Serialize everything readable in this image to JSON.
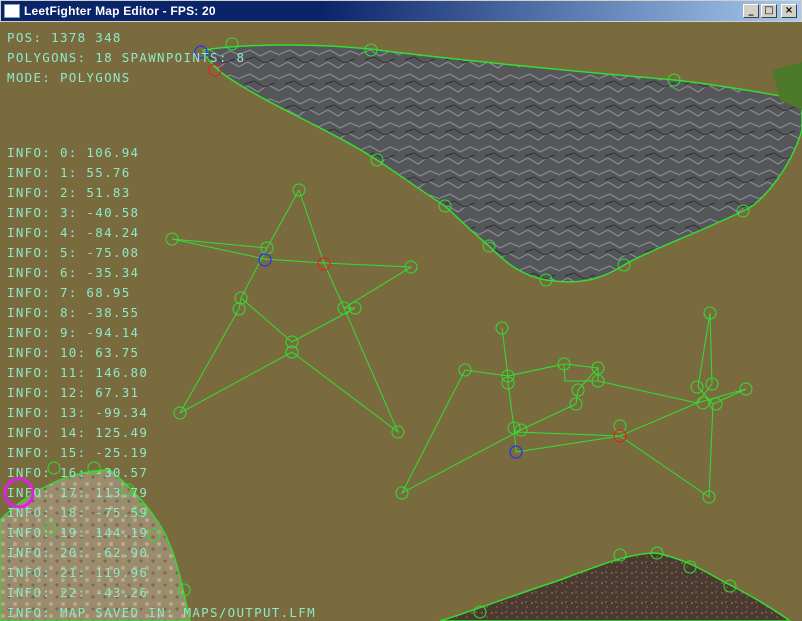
{
  "window": {
    "title": "LeetFighter Map Editor - FPS: 20",
    "minimize": "_",
    "maximize": "□",
    "close": "×"
  },
  "hud": {
    "pos": "Pos: 1378 348",
    "counts": "Polygons: 18 Spawnpoints: 8",
    "mode": "Mode: Polygons"
  },
  "info": [
    "Info: 0: 106.94",
    "Info: 1: 55.76",
    "Info: 2: 51.83",
    "Info: 3: -40.58",
    "Info: 4: -84.24",
    "Info: 5: -75.08",
    "Info: 6: -35.34",
    "Info: 7: 68.95",
    "Info: 8: -38.55",
    "Info: 9: -94.14",
    "Info: 10: 63.75",
    "Info: 11: 146.80",
    "Info: 12: 67.31",
    "Info: 13: -99.34",
    "Info: 14: 125.49",
    "Info: 15: -25.19",
    "Info: 16: -30.57",
    "Info: 17: 113.79",
    "Info: 18: -75.59",
    "Info: 19: 144.19",
    "Info: 20: -62.90",
    "Info: 21: 119.96",
    "Info: 22: -43.26",
    "Info: Map saved in: maps/output.lfm"
  ],
  "colors": {
    "background": "#7a6b3e",
    "polygon_edge": "#33dd33",
    "rock": "#55565a",
    "gravel": "#4a3a30",
    "hud_text": "#8ee8c8",
    "cursor": "#e020e0"
  }
}
